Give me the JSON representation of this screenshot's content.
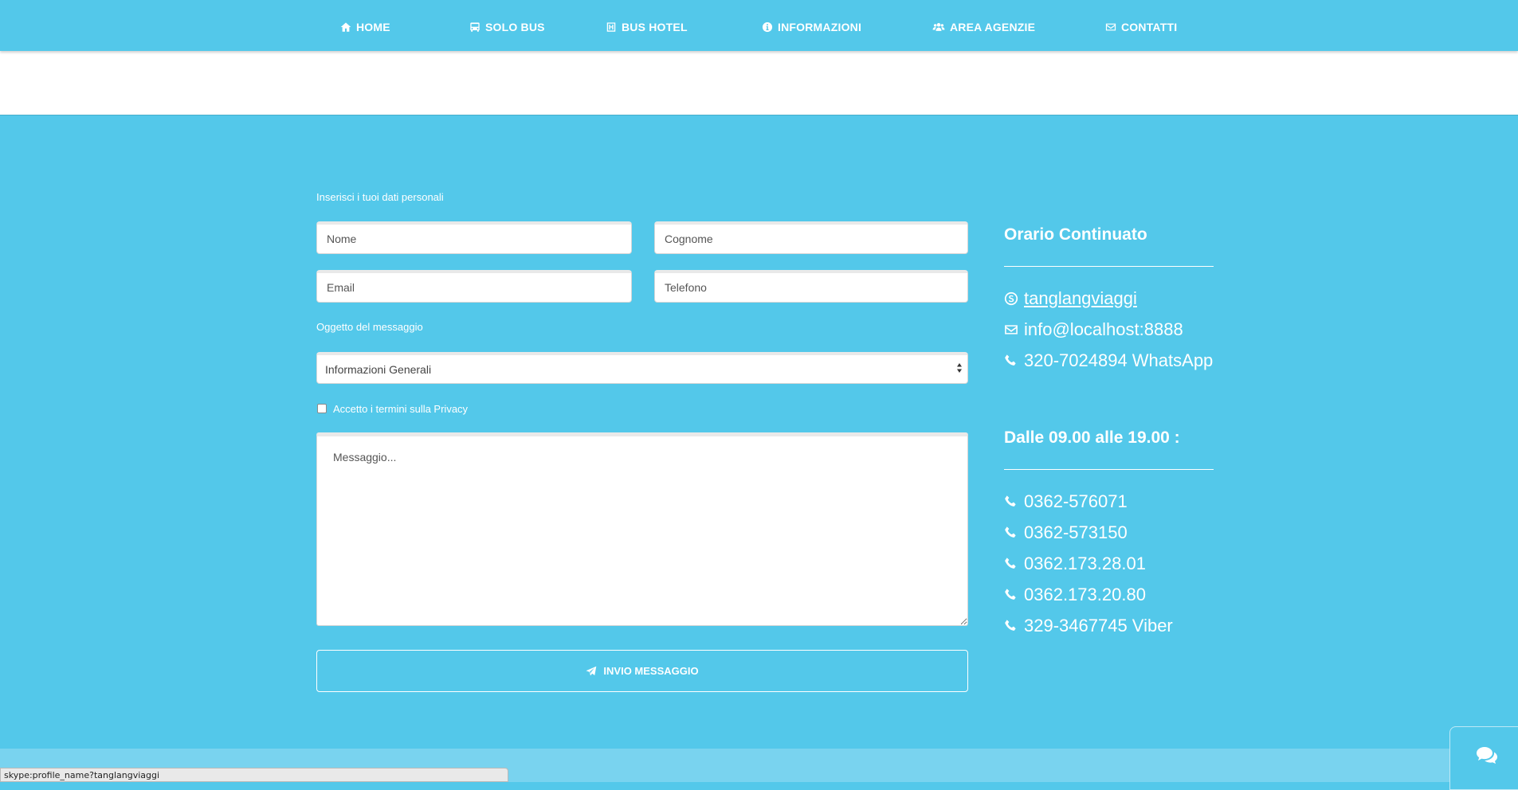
{
  "nav": {
    "items": [
      {
        "label": "HOME",
        "icon": "home-icon"
      },
      {
        "label": "SOLO BUS",
        "icon": "bus-icon"
      },
      {
        "label": "BUS HOTEL",
        "icon": "hotel-icon"
      },
      {
        "label": "INFORMAZIONI",
        "icon": "info-icon"
      },
      {
        "label": "AREA AGENZIE",
        "icon": "users-icon"
      },
      {
        "label": "CONTATTI",
        "icon": "envelope-icon"
      }
    ]
  },
  "form": {
    "personal_label": "Inserisci i tuoi dati personali",
    "nome_placeholder": "Nome",
    "cognome_placeholder": "Cognome",
    "email_placeholder": "Email",
    "telefono_placeholder": "Telefono",
    "subject_label": "Oggetto del messaggio",
    "subject_selected": "Informazioni Generali",
    "privacy_label": "Accetto i termini sulla Privacy",
    "privacy_checked": false,
    "message_placeholder": "Messaggio...",
    "submit_label": "INVIO MESSAGGIO"
  },
  "sidebar": {
    "hours_heading": "Orario Continuato",
    "contacts": [
      {
        "icon": "skype-icon",
        "text": "tanglangviaggi",
        "link": true
      },
      {
        "icon": "envelope-icon",
        "text": "info@localhost:8888",
        "link": false
      },
      {
        "icon": "phone-icon",
        "text": "320-7024894 WhatsApp",
        "link": false
      }
    ],
    "schedule_heading": "Dalle 09.00 alle 19.00 :",
    "phones": [
      "0362-576071",
      "0362-573150",
      "0362.173.28.01",
      "0362.173.20.80",
      "329-3467745 Viber"
    ]
  },
  "status_bar": {
    "text": "skype:profile_name?tanglangviaggi"
  },
  "colors": {
    "accent": "#53c8ea",
    "footer": "#79d3ef",
    "text": "#ffffff"
  }
}
